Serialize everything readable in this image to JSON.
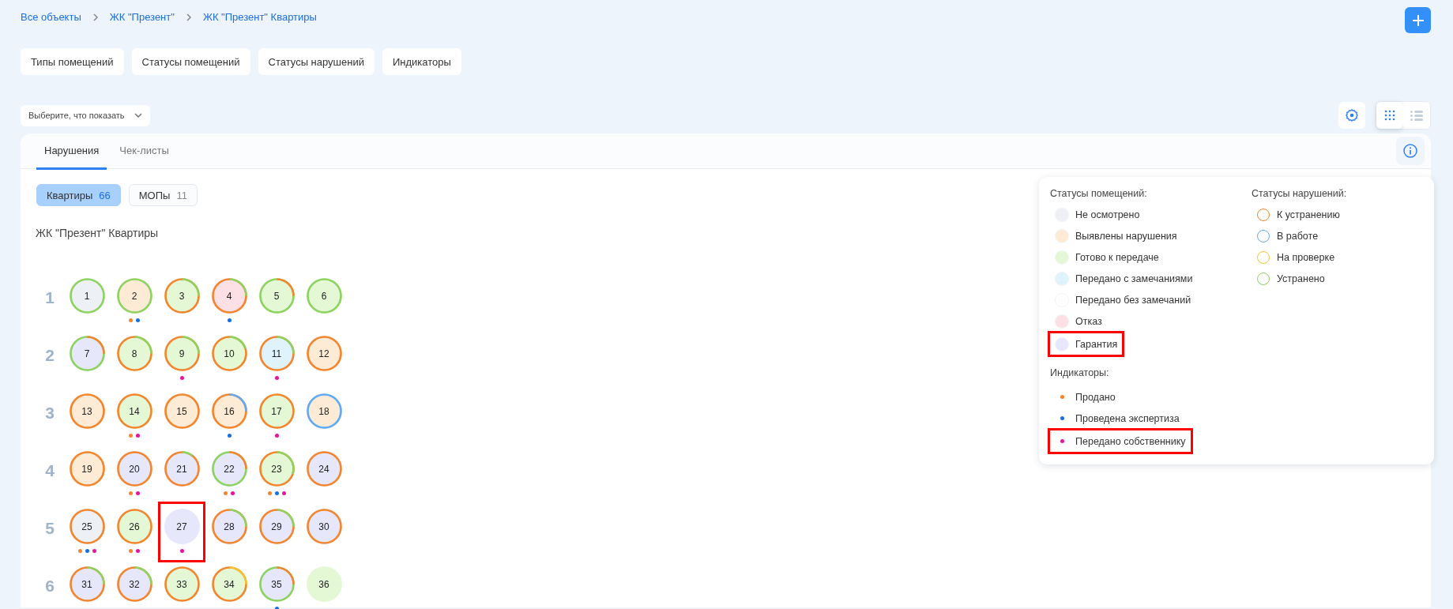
{
  "breadcrumbs": [
    "Все объекты",
    "ЖК \"Презент\"",
    "ЖК \"Презент\" Квартиры"
  ],
  "filter_buttons": [
    "Типы помещений",
    "Статусы помещений",
    "Статусы нарушений",
    "Индикаторы"
  ],
  "display_select": {
    "placeholder": "Выберите, что показать"
  },
  "view_toggle": [
    {
      "kind": "grid",
      "selected": true
    },
    {
      "kind": "list",
      "selected": false
    }
  ],
  "tabs": [
    {
      "label": "Нарушения",
      "selected": true
    },
    {
      "label": "Чек-листы",
      "selected": false
    }
  ],
  "segments": [
    {
      "label": "Квартиры",
      "count": "66",
      "selected": true
    },
    {
      "label": "МОПы",
      "count": "11",
      "selected": false
    }
  ],
  "section_title": "ЖК \"Презент\" Квартиры",
  "floors": [
    {
      "label": "1",
      "rooms": [
        {
          "number": "1",
          "color": "#edf1f6",
          "ring": {
            "color": "#8dd35f"
          },
          "highlighted": false
        },
        {
          "number": "2",
          "color": "#fdebd6",
          "ring": {
            "color": "#8dd35f"
          },
          "indicators": [
            {
              "color": "#f5852d"
            },
            {
              "color": "#1a6fe0"
            }
          ],
          "highlighted": false
        },
        {
          "number": "3",
          "color": "#e5f8d6",
          "ring": {
            "color": "#f5852d",
            "arc": {
              "color": "#8dd35f",
              "level": 0.25
            }
          },
          "highlighted": false
        },
        {
          "number": "4",
          "color": "#fde0e5",
          "ring": {
            "color": "#f5852d",
            "arc": {
              "color": "#8dd35f",
              "level": 0.25
            }
          },
          "indicators": [
            {
              "color": "#1a6fe0"
            }
          ],
          "highlighted": false
        },
        {
          "number": "5",
          "color": "#e5f8d6",
          "ring": {
            "color": "#8dd35f",
            "arc": {
              "color": "#f5852d",
              "level": 0.25
            }
          },
          "highlighted": false
        },
        {
          "number": "6",
          "color": "#e5f8d6",
          "ring": {
            "color": "#8dd35f"
          },
          "highlighted": false
        }
      ]
    },
    {
      "label": "2",
      "rooms": [
        {
          "number": "7",
          "color": "#e7e7fb",
          "ring": {
            "color": "#8dd35f",
            "arc": {
              "color": "#f5852d",
              "level": 0.25
            }
          },
          "highlighted": false
        },
        {
          "number": "8",
          "color": "#e5f8d6",
          "ring": {
            "color": "#f5852d",
            "arc": {
              "color": "#8dd35f",
              "level": 0.25
            }
          },
          "highlighted": false
        },
        {
          "number": "9",
          "color": "#e5f8d6",
          "ring": {
            "color": "#f5852d",
            "arc": {
              "color": "#8dd35f",
              "level": 0.25
            }
          },
          "indicators": [
            {
              "color": "#e6169b"
            }
          ],
          "highlighted": false
        },
        {
          "number": "10",
          "color": "#e5f8d6",
          "ring": {
            "color": "#f5852d",
            "arc": {
              "color": "#8dd35f",
              "level": 0.2
            }
          },
          "highlighted": false
        },
        {
          "number": "11",
          "color": "#def3fb",
          "ring": {
            "color": "#f5852d",
            "arc": {
              "color": "#8dd35f",
              "level": 0.25
            }
          },
          "indicators": [
            {
              "color": "#e6169b"
            }
          ],
          "highlighted": false
        },
        {
          "number": "12",
          "color": "#fdebd6",
          "ring": {
            "color": "#f5852d"
          },
          "highlighted": false
        }
      ]
    },
    {
      "label": "3",
      "rooms": [
        {
          "number": "13",
          "color": "#fdebd6",
          "ring": {
            "color": "#f5852d"
          },
          "highlighted": false
        },
        {
          "number": "14",
          "color": "#e5f8d6",
          "ring": {
            "color": "#f5852d"
          },
          "indicators": [
            {
              "color": "#f5852d"
            },
            {
              "color": "#e6169b"
            }
          ],
          "highlighted": false
        },
        {
          "number": "15",
          "color": "#fdebd6",
          "ring": {
            "color": "#f5852d"
          },
          "highlighted": false
        },
        {
          "number": "16",
          "color": "#fdebd6",
          "ring": {
            "color": "#f5852d",
            "arc": {
              "color": "#5eaaf5",
              "level": 0.25
            }
          },
          "indicators": [
            {
              "color": "#1a6fe0"
            }
          ],
          "highlighted": false
        },
        {
          "number": "17",
          "color": "#e5f8d6",
          "ring": {
            "color": "#f5852d"
          },
          "indicators": [
            {
              "color": "#e6169b"
            }
          ],
          "highlighted": false
        },
        {
          "number": "18",
          "color": "#fdebd6",
          "ring": {
            "color": "#5eaaf5"
          },
          "highlighted": false
        }
      ]
    },
    {
      "label": "4",
      "rooms": [
        {
          "number": "19",
          "color": "#fdebd6",
          "ring": {
            "color": "#f5852d"
          },
          "highlighted": false
        },
        {
          "number": "20",
          "color": "#e7e7fb",
          "ring": {
            "color": "#f5852d"
          },
          "indicators": [
            {
              "color": "#f5852d"
            },
            {
              "color": "#e6169b"
            }
          ],
          "highlighted": false
        },
        {
          "number": "21",
          "color": "#e7e7fb",
          "ring": {
            "color": "#f5852d",
            "arc": {
              "color": "#8dd35f",
              "level": 0.1
            }
          },
          "highlighted": false
        },
        {
          "number": "22",
          "color": "#e7e7fb",
          "ring": {
            "color": "#8dd35f",
            "arc": {
              "color": "#f5852d",
              "level": 0.25
            }
          },
          "indicators": [
            {
              "color": "#f5852d"
            },
            {
              "color": "#e6169b"
            }
          ],
          "highlighted": false
        },
        {
          "number": "23",
          "color": "#e5f8d6",
          "ring": {
            "color": "#f5852d",
            "arc": {
              "color": "#8dd35f",
              "level": 0.3
            }
          },
          "indicators": [
            {
              "color": "#f5852d"
            },
            {
              "color": "#1a6fe0"
            },
            {
              "color": "#e6169b"
            }
          ],
          "highlighted": false
        },
        {
          "number": "24",
          "color": "#e7e7fb",
          "ring": {
            "color": "#f5852d"
          },
          "highlighted": false
        }
      ]
    },
    {
      "label": "5",
      "rooms": [
        {
          "number": "25",
          "color": "#edf1f6",
          "ring": {
            "color": "#f5852d"
          },
          "indicators": [
            {
              "color": "#f5852d"
            },
            {
              "color": "#1a6fe0"
            },
            {
              "color": "#e6169b"
            }
          ],
          "highlighted": false
        },
        {
          "number": "26",
          "color": "#e5f8d6",
          "ring": {
            "color": "#f5852d"
          },
          "indicators": [
            {
              "color": "#f5852d"
            },
            {
              "color": "#e6169b"
            }
          ],
          "highlighted": false
        },
        {
          "number": "27",
          "color": "#e7e7fb",
          "indicators": [
            {
              "color": "#e6169b"
            }
          ],
          "highlighted": true
        },
        {
          "number": "28",
          "color": "#e7e7fb",
          "ring": {
            "color": "#f5852d",
            "arc": {
              "color": "#8dd35f",
              "level": 0.25
            }
          },
          "highlighted": false
        },
        {
          "number": "29",
          "color": "#e7e7fb",
          "ring": {
            "color": "#f5852d",
            "arc": {
              "color": "#8dd35f",
              "level": 0.25
            }
          },
          "highlighted": false
        },
        {
          "number": "30",
          "color": "#e7e7fb",
          "ring": {
            "color": "#f5852d"
          },
          "highlighted": false
        }
      ]
    },
    {
      "label": "6",
      "rooms": [
        {
          "number": "31",
          "color": "#e7e7fb",
          "ring": {
            "color": "#f5852d",
            "arc": {
              "color": "#8dd35f",
              "level": 0.25
            }
          },
          "highlighted": false
        },
        {
          "number": "32",
          "color": "#e7e7fb",
          "ring": {
            "color": "#f5852d",
            "arc": {
              "color": "#8dd35f",
              "level": 0.25
            }
          },
          "highlighted": false
        },
        {
          "number": "33",
          "color": "#e5f8d6",
          "ring": {
            "color": "#f5852d"
          },
          "highlighted": false
        },
        {
          "number": "34",
          "color": "#e5f8d6",
          "ring": {
            "color": "#f5852d",
            "arc": {
              "color": "#f7c132",
              "level": 0.25
            }
          },
          "highlighted": false
        },
        {
          "number": "35",
          "color": "#e7e7fb",
          "ring": {
            "color": "#8dd35f",
            "arc": {
              "color": "#f5852d",
              "level": 0.25
            }
          },
          "indicators": [
            {
              "color": "#1a6fe0"
            }
          ],
          "highlighted": false
        },
        {
          "number": "36",
          "color": "#e5f8d6",
          "highlighted": false
        }
      ]
    }
  ],
  "legend": {
    "room_statuses": {
      "title": "Статусы помещений:",
      "items": [
        {
          "label": "Не осмотрено",
          "color": "#edf1f6",
          "highlighted": false
        },
        {
          "label": "Выявлены нарушения",
          "color": "#fdebd6",
          "highlighted": false
        },
        {
          "label": "Готово к передаче",
          "color": "#e5f8d6",
          "highlighted": false
        },
        {
          "label": "Передано с замечаниями",
          "color": "#def3fb",
          "highlighted": false
        },
        {
          "label": "Передано без замечаний",
          "color": "#ffffff",
          "highlighted": false
        },
        {
          "label": "Отказ",
          "color": "#fde0e5",
          "highlighted": false
        },
        {
          "label": "Гарантия",
          "color": "#e7e7fb",
          "highlighted": true
        }
      ]
    },
    "violation_statuses": {
      "title": "Статусы нарушений:",
      "items": [
        {
          "label": "К устранению",
          "color": "#f5852d"
        },
        {
          "label": "В работе",
          "color": "#5eaaf5"
        },
        {
          "label": "На проверке",
          "color": "#f7c132"
        },
        {
          "label": "Устранено",
          "color": "#8dd35f"
        }
      ]
    },
    "indicators": {
      "title": "Индикаторы:",
      "items": [
        {
          "label": "Продано",
          "color": "#f5852d",
          "highlighted": false
        },
        {
          "label": "Проведена экспертиза",
          "color": "#1a6fe0",
          "highlighted": false
        },
        {
          "label": "Передано собственнику",
          "color": "#e6169b",
          "highlighted": true
        }
      ]
    }
  }
}
